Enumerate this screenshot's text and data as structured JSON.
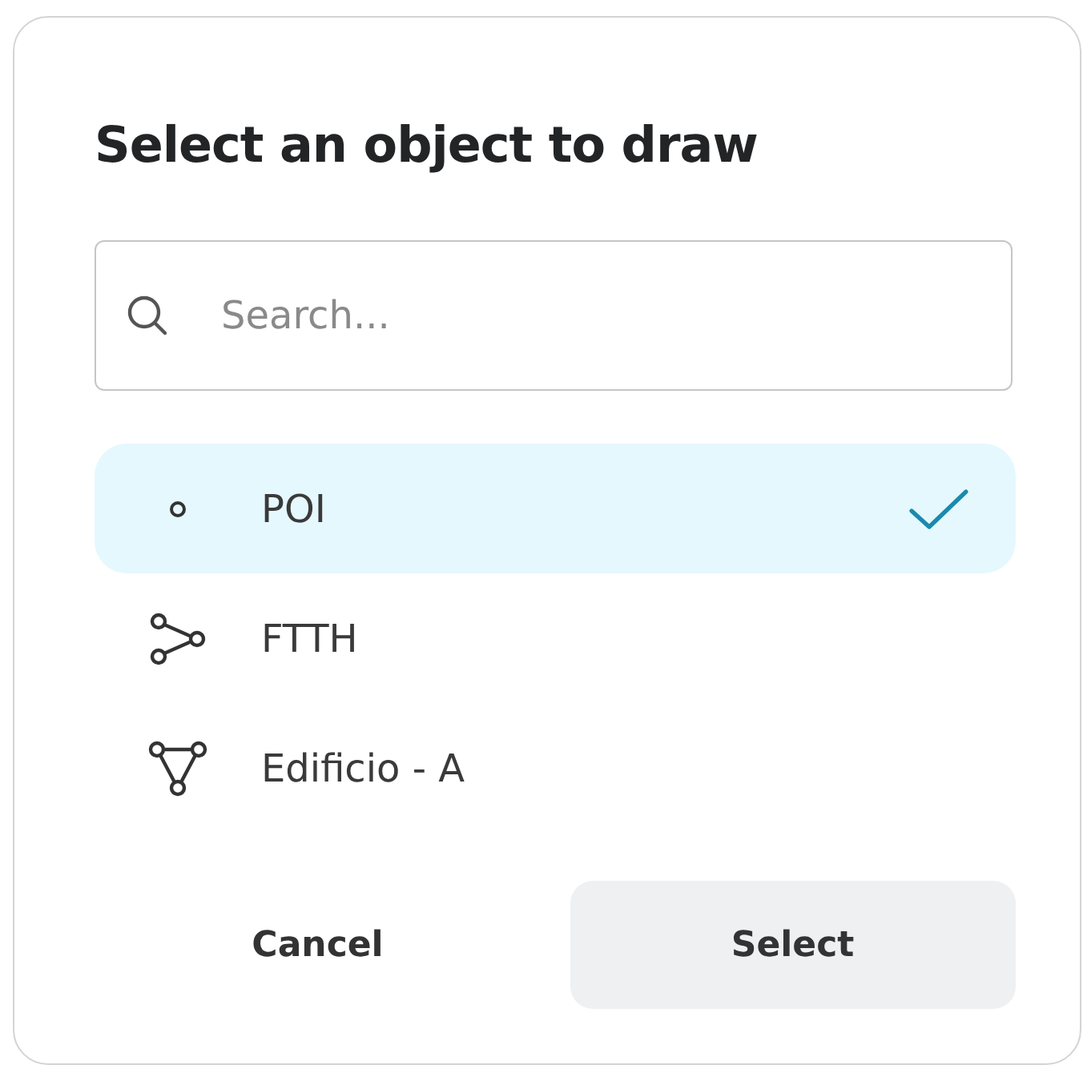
{
  "dialog": {
    "title": "Select an object to draw"
  },
  "search": {
    "placeholder": "Search..."
  },
  "items": [
    {
      "label": "POI",
      "kind": "point",
      "selected": true
    },
    {
      "label": "FTTH",
      "kind": "line",
      "selected": false
    },
    {
      "label": "Edificio - A",
      "kind": "polygon",
      "selected": false
    }
  ],
  "buttons": [
    {
      "label": "Cancel",
      "kind": "text"
    },
    {
      "label": "Select",
      "kind": "filled"
    }
  ]
}
